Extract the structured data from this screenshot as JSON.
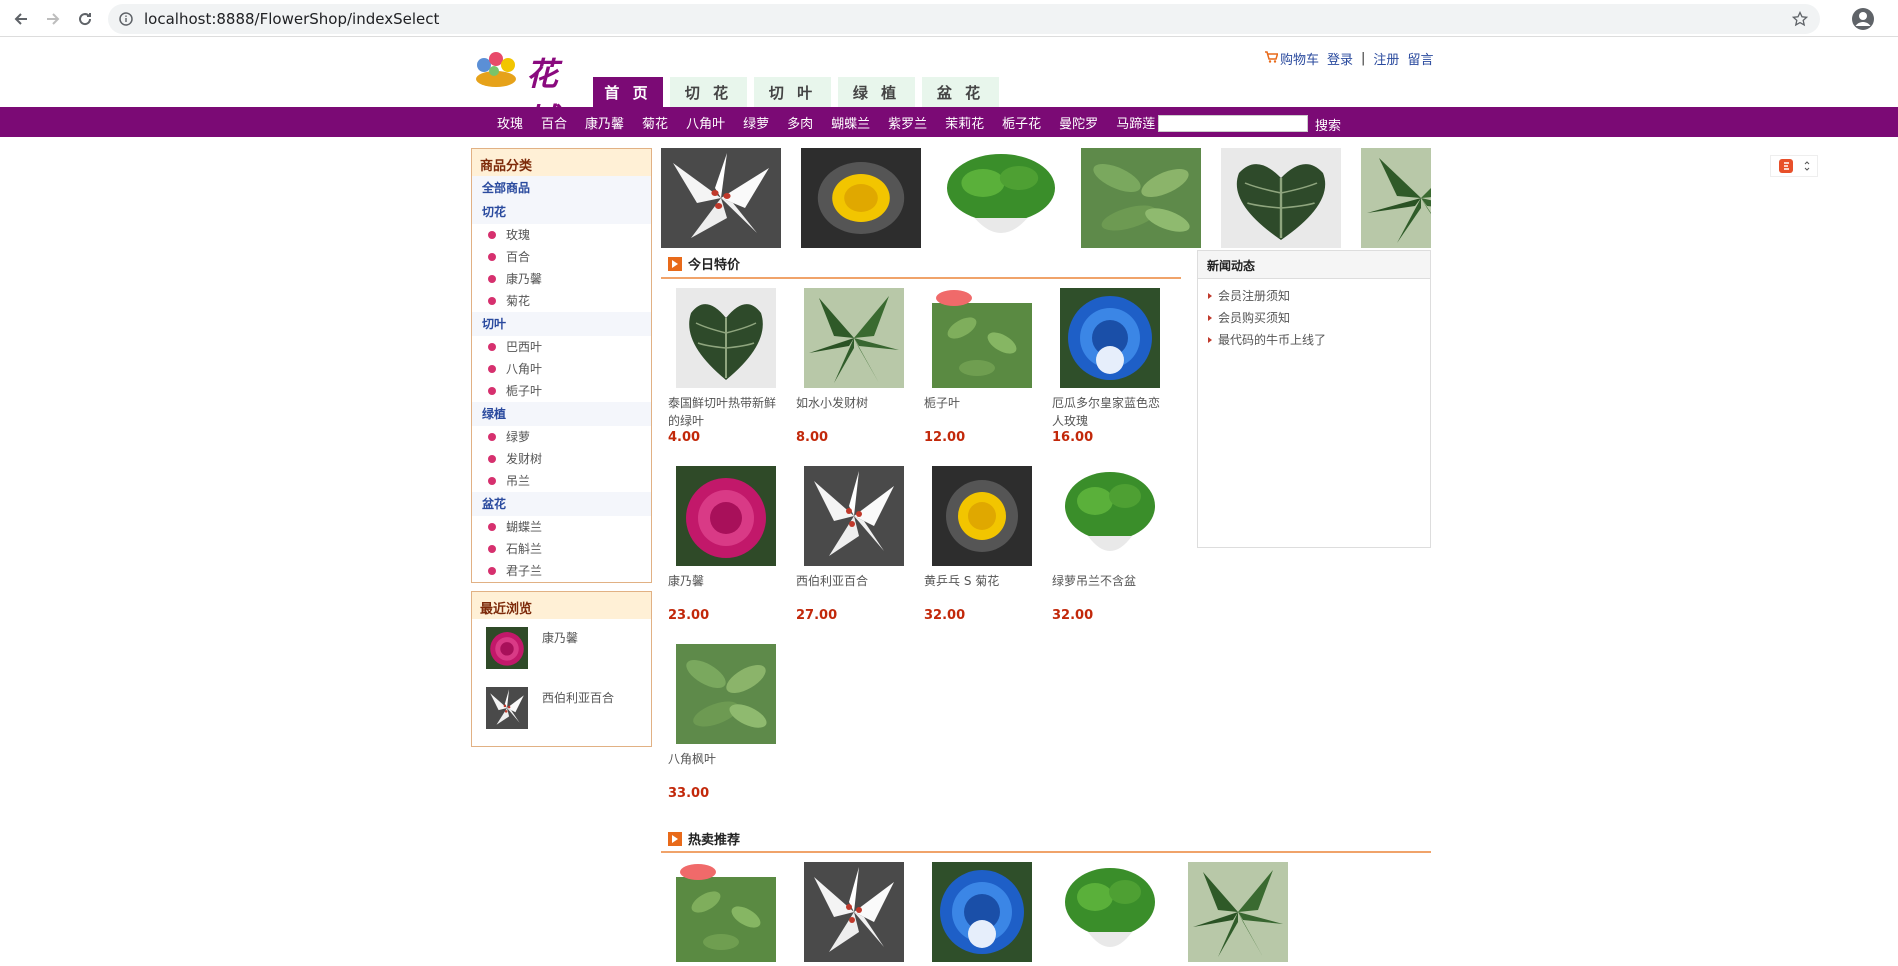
{
  "browser": {
    "url": "localhost:8888/FlowerShop/indexSelect"
  },
  "header": {
    "logo_text": "花城",
    "links": {
      "cart": "购物车",
      "login": "登录",
      "sep": "|",
      "register": "注册",
      "message": "留言"
    },
    "tabs": [
      "首 页",
      "切 花",
      "切 叶",
      "绿 植",
      "盆 花"
    ]
  },
  "catbar": {
    "items": [
      "玫瑰",
      "百合",
      "康乃馨",
      "菊花",
      "八角叶",
      "绿萝",
      "多肉",
      "蝴蝶兰",
      "紫罗兰",
      "茉莉花",
      "栀子花",
      "曼陀罗",
      "马蹄莲"
    ],
    "search_button": "搜索"
  },
  "sidebar": {
    "title": "商品分类",
    "all": "全部商品",
    "groups": [
      {
        "name": "切花",
        "items": [
          "玫瑰",
          "百合",
          "康乃馨",
          "菊花"
        ]
      },
      {
        "name": "切叶",
        "items": [
          "巴西叶",
          "八角叶",
          "栀子叶"
        ]
      },
      {
        "name": "绿植",
        "items": [
          "绿萝",
          "发财树",
          "吊兰"
        ]
      },
      {
        "name": "盆花",
        "items": [
          "蝴蝶兰",
          "石斛兰",
          "君子兰"
        ]
      }
    ],
    "recent_title": "最近浏览",
    "recent": [
      "康乃馨",
      "西伯利亚百合"
    ]
  },
  "today": {
    "title": "今日特价",
    "products": [
      {
        "name": "泰国鲜切叶热带新鲜的绿叶",
        "price": "4.00"
      },
      {
        "name": "如水小发财树",
        "price": "8.00"
      },
      {
        "name": "栀子叶",
        "price": "12.00"
      },
      {
        "name": "厄瓜多尔皇家蓝色恋人玫瑰",
        "price": "16.00"
      },
      {
        "name": "康乃馨",
        "price": "23.00"
      },
      {
        "name": "西伯利亚百合",
        "price": "27.00"
      },
      {
        "name": "黄乒乓 S 菊花",
        "price": "32.00"
      },
      {
        "name": "绿萝吊兰不含盆",
        "price": "32.00"
      },
      {
        "name": "八角枫叶",
        "price": "33.00"
      }
    ]
  },
  "news": {
    "title": "新闻动态",
    "items": [
      "会员注册须知",
      "会员购买须知",
      "最代码的牛币上线了"
    ]
  },
  "hot": {
    "title": "热卖推荐"
  },
  "colors": {
    "brand": "#7b0a75",
    "price": "#c2280a",
    "accent": "#e86a1a"
  }
}
